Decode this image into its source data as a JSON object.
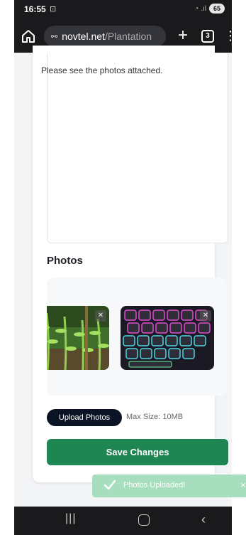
{
  "status_bar": {
    "time": "16:55",
    "cast_icon": "screen-record-icon",
    "battery": "65"
  },
  "browser": {
    "home_icon": "home-icon",
    "url_icon": "site-info-icon",
    "url_host": "novtel.net",
    "url_path": "/Plantation",
    "new_tab_icon": "plus-icon",
    "tab_count": "3",
    "menu_icon": "more-vert-icon"
  },
  "form": {
    "description_text": "Please see the photos attached.",
    "photos_heading": "Photos",
    "photos": [
      {
        "name": "plant-photo",
        "close_icon": "close-icon"
      },
      {
        "name": "keyboard-photo",
        "close_icon": "close-icon"
      }
    ],
    "upload_label": "Upload Photos",
    "max_size": "Max Size: 10MB",
    "save_label": "Save Changes"
  },
  "toast": {
    "message": "Photos Uploaded!",
    "icon": "check-icon",
    "close": "×"
  },
  "nav": {
    "recent": "|||",
    "back": "‹"
  },
  "colors": {
    "save_button": "#1e8553",
    "upload_button": "#0b1424",
    "toast": "#a7dfbe",
    "chrome": "#1a1a1d"
  }
}
